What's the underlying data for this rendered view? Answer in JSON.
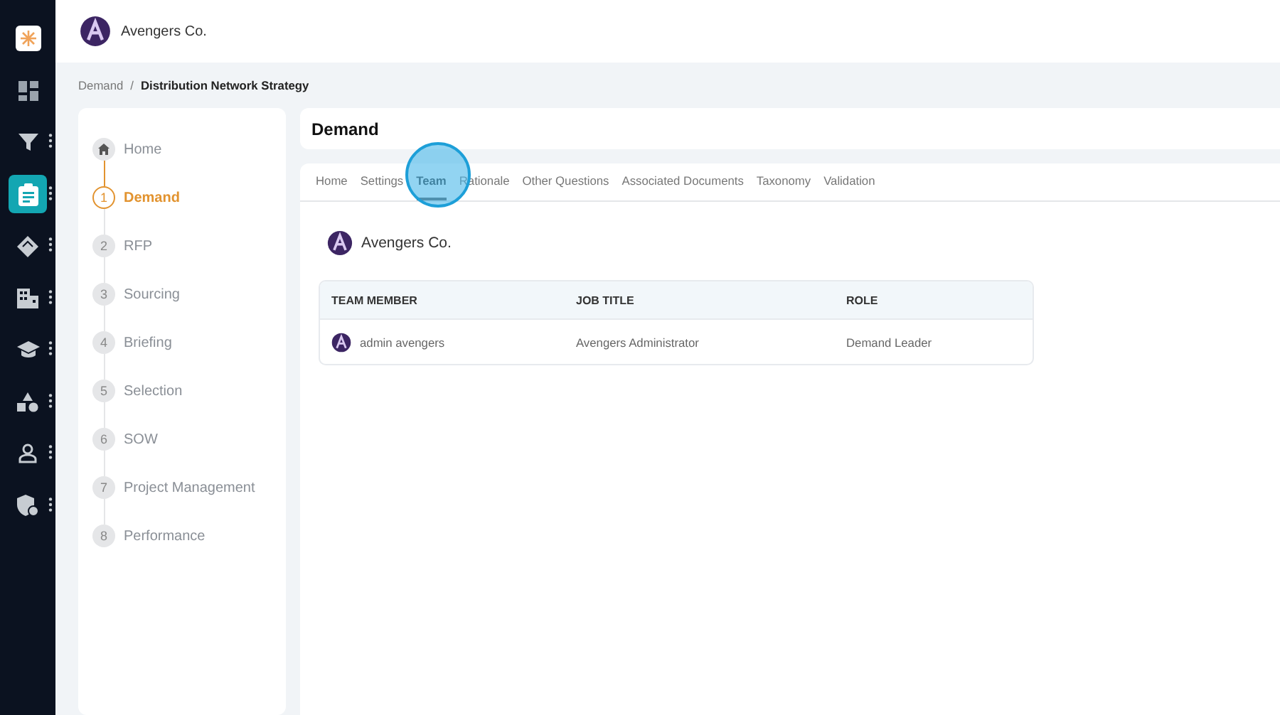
{
  "rail": [
    {
      "kind": "logo",
      "selected": false,
      "menu": false
    },
    {
      "kind": "dashboard",
      "selected": false,
      "menu": false
    },
    {
      "kind": "filter",
      "selected": false,
      "menu": true
    },
    {
      "kind": "clipboard",
      "selected": true,
      "menu": true
    },
    {
      "kind": "tag",
      "selected": false,
      "menu": true
    },
    {
      "kind": "building",
      "selected": false,
      "menu": true
    },
    {
      "kind": "cap",
      "selected": false,
      "menu": true
    },
    {
      "kind": "shapes",
      "selected": false,
      "menu": true
    },
    {
      "kind": "person",
      "selected": false,
      "menu": true
    },
    {
      "kind": "shield",
      "selected": false,
      "menu": true
    }
  ],
  "header": {
    "company": "Avengers Co."
  },
  "breadcrumb_separator": "/",
  "breadcrumb": [
    {
      "label": "Demand",
      "current": false
    },
    {
      "label": "Distribution Network Strategy",
      "current": true
    }
  ],
  "steps": [
    {
      "kind": "home",
      "label": "Home",
      "selected": false
    },
    {
      "kind": "step",
      "number": "1",
      "label": "Demand",
      "selected": true
    },
    {
      "kind": "step",
      "number": "2",
      "label": "RFP",
      "selected": false
    },
    {
      "kind": "step",
      "number": "3",
      "label": "Sourcing",
      "selected": false
    },
    {
      "kind": "step",
      "number": "4",
      "label": "Briefing",
      "selected": false
    },
    {
      "kind": "step",
      "number": "5",
      "label": "Selection",
      "selected": false
    },
    {
      "kind": "step",
      "number": "6",
      "label": "SOW",
      "selected": false
    },
    {
      "kind": "step",
      "number": "7",
      "label": "Project Management",
      "selected": false
    },
    {
      "kind": "step",
      "number": "8",
      "label": "Performance",
      "selected": false
    }
  ],
  "page_title": "Demand",
  "tabs": [
    {
      "label": "Home",
      "selected": false
    },
    {
      "label": "Settings",
      "selected": false
    },
    {
      "label": "Team",
      "selected": true
    },
    {
      "label": "Rationale",
      "selected": false
    },
    {
      "label": "Other Questions",
      "selected": false
    },
    {
      "label": "Associated Documents",
      "selected": false
    },
    {
      "label": "Taxonomy",
      "selected": false
    },
    {
      "label": "Validation",
      "selected": false
    }
  ],
  "team": {
    "company": "Avengers Co.",
    "columns": [
      "TEAM MEMBER",
      "JOB TITLE",
      "ROLE"
    ],
    "rows": [
      [
        "admin avengers",
        "Avengers Administrator",
        "Demand Leader"
      ]
    ]
  }
}
